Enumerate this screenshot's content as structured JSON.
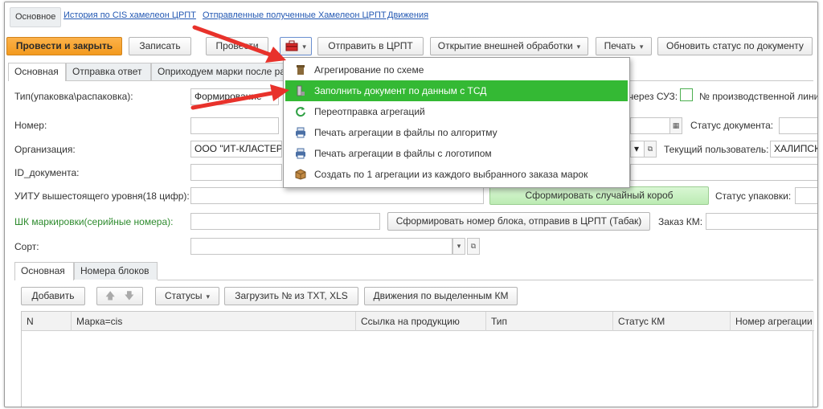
{
  "nav": {
    "items": [
      {
        "label": "Основное",
        "active": true
      },
      {
        "label": "История по CIS хамелеон ЦРПТ"
      },
      {
        "label": "Отправленные полученные Хамелеон ЦРПТ"
      },
      {
        "label": "Движения"
      }
    ]
  },
  "toolbar": {
    "post_close": "Провести и закрыть",
    "save": "Записать",
    "post": "Провести",
    "send_crpt": "Отправить в ЦРПТ",
    "open_external": "Открытие внешней обработки",
    "print": "Печать",
    "update_status": "Обновить статус по документу"
  },
  "tabs": [
    "Основная",
    "Отправка ответ",
    "Оприходуем марки после ра"
  ],
  "form": {
    "type_label": "Тип(упаковка\\распаковка):",
    "type_value": "Формирование",
    "via_suz_label": "через СУЗ:",
    "prod_line_label": "№ производственной линии",
    "number_label": "Номер:",
    "doc_status_label": "Статус документа:",
    "org_label": "Организация:",
    "org_value": "ООО \"ИТ-КЛАСТЕР",
    "current_user_label": "Текущий пользователь:",
    "current_user_value": "ХАЛИПСКИ",
    "id_doc_label": "ID_документа:",
    "uitu_label": "УИТУ вышестоящего уровня(18 цифр):",
    "random_box_button": "Сформировать случайный короб",
    "pack_status_label": "Статус упаковки:",
    "shk_label": "ШК маркировки(серийные номера):",
    "block_number_button": "Сформировать номер блока, отправив в ЦРПТ (Табак)",
    "order_km_label": "Заказ КМ:",
    "sort_label": "Сорт:"
  },
  "inner_tabs": [
    "Основная",
    "Номера блоков"
  ],
  "table_toolbar": {
    "add": "Добавить",
    "statuses": "Статусы",
    "load_txt": "Загрузить № из TXT, XLS",
    "movements": "Движения по выделенным КМ"
  },
  "table": {
    "columns": [
      "N",
      "Марка=cis",
      "Ссылка на продукцию",
      "Тип",
      "Статус КМ",
      "Номер агрегации"
    ]
  },
  "menu": {
    "items": [
      {
        "label": "Агрегирование по схеме",
        "icon": "tower-icon"
      },
      {
        "label": "Заполнить документ по данным с ТСД",
        "icon": "scanner-icon",
        "highlighted": true
      },
      {
        "label": "Переотправка агрегаций",
        "icon": "refresh-icon"
      },
      {
        "label": "Печать агрегации в файлы по алгоритму",
        "icon": "printer-icon"
      },
      {
        "label": "Печать агрегации в файлы с логотипом",
        "icon": "printer-icon"
      },
      {
        "label": "Создать по 1 агрегации из каждого выбранного заказа марок",
        "icon": "box-icon"
      }
    ]
  },
  "colors": {
    "primary_button": "#f39a1e",
    "menu_highlight": "#34b934",
    "link": "#2459b3",
    "arrow": "#e8322b",
    "green_label": "#2e8b2e"
  }
}
